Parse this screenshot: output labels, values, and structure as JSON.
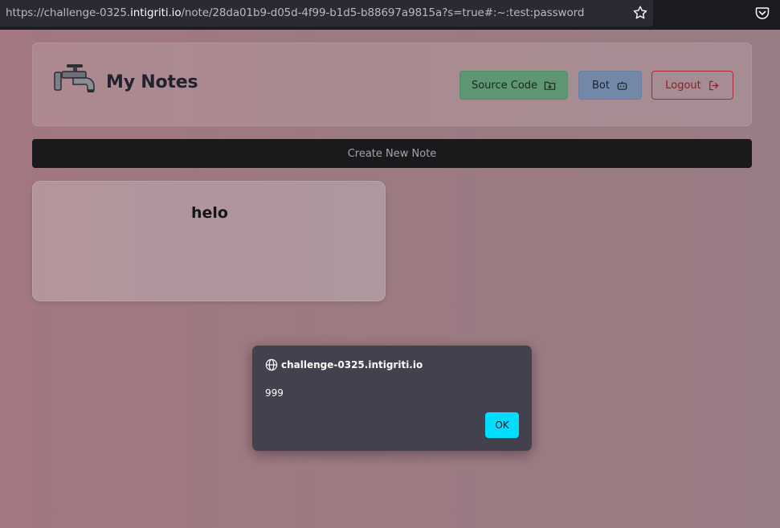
{
  "browser": {
    "url_prefix": "https://challenge-0325.",
    "url_host": "intigriti.io",
    "url_suffix": "/note/28da01b9-d05d-4f99-b1d5-b88697a9815a?s=true#:~:test:password"
  },
  "header": {
    "title": "My Notes",
    "source_code_label": "Source Code",
    "bot_label": "Bot",
    "logout_label": "Logout"
  },
  "create_label": "Create New Note",
  "notes": [
    {
      "title": "helo"
    }
  ],
  "dialog": {
    "origin": "challenge-0325.intigriti.io",
    "message": "999",
    "ok_label": "OK"
  },
  "colors": {
    "ok_button": "#00ddff",
    "source_button": "#5e9671",
    "bot_button": "#7388a6",
    "logout_border": "#b02a34"
  }
}
